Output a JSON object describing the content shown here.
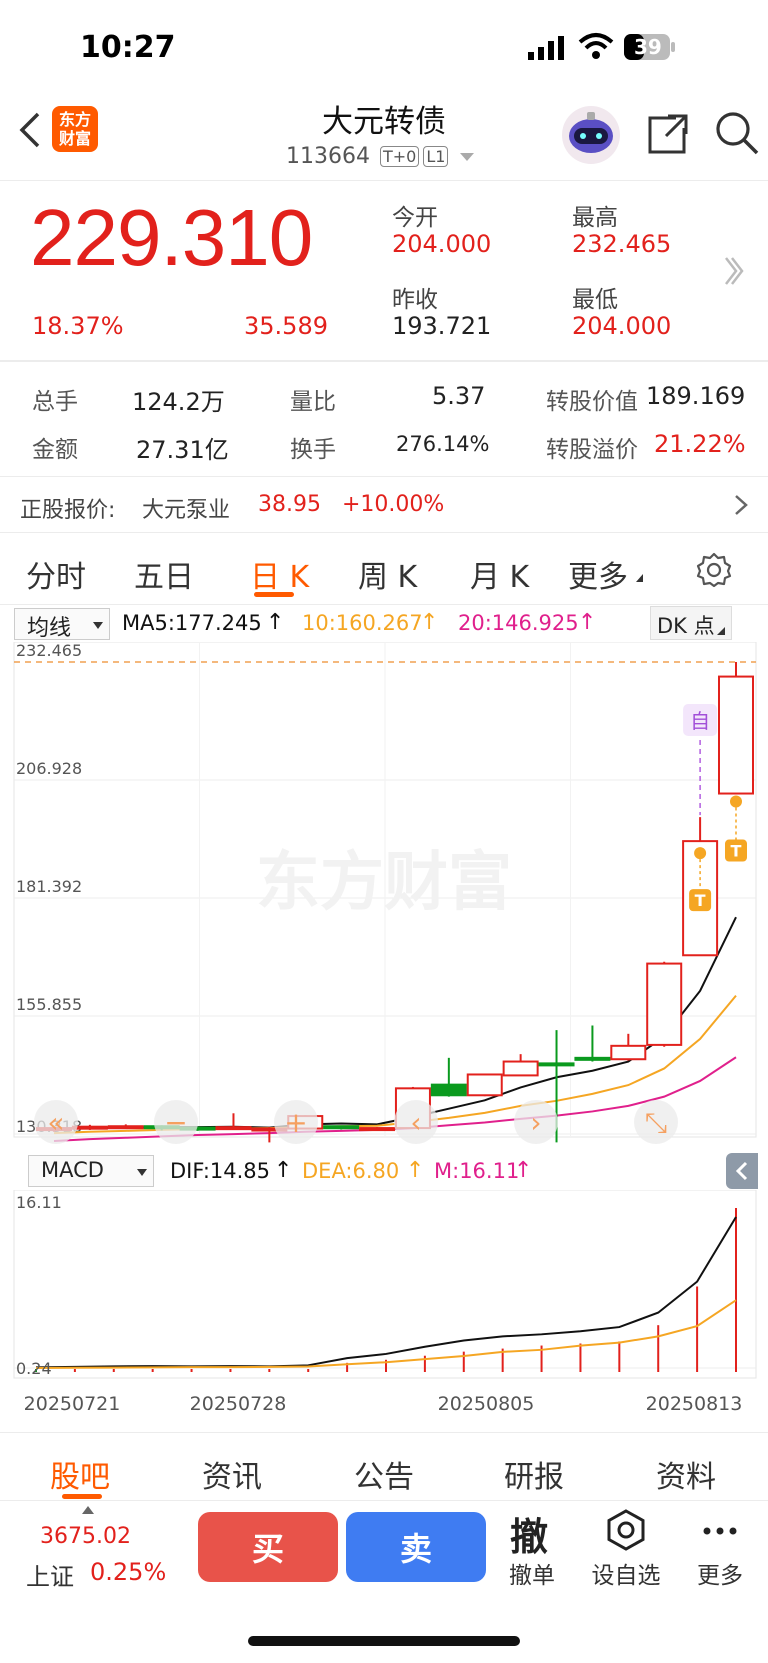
{
  "status_bar": {
    "time": "10:27",
    "battery": "39"
  },
  "header": {
    "logo_text": "东方\n财富",
    "title": "大元转债",
    "code": "113664",
    "badge_t0": "T+0",
    "badge_l1": "L1"
  },
  "quote": {
    "price": "229.310",
    "change_pct": "18.37%",
    "change_abs": "35.589",
    "open_label": "今开",
    "open": "204.000",
    "high_label": "最高",
    "high": "232.465",
    "prev_close_label": "昨收",
    "prev_close": "193.721",
    "low_label": "最低",
    "low": "204.000"
  },
  "stats": {
    "volume_label": "总手",
    "volume": "124.2万",
    "vol_ratio_label": "量比",
    "vol_ratio": "5.37",
    "conv_value_label": "转股价值",
    "conv_value": "189.169",
    "amount_label": "金额",
    "amount": "27.31亿",
    "turnover_label": "换手",
    "turnover": "276.14%",
    "premium_label": "转股溢价",
    "premium": "21.22%"
  },
  "stock_quote": {
    "label": "正股报价:",
    "name": "大元泵业",
    "price": "38.95",
    "change": "+10.00%"
  },
  "chart_tabs": [
    "分时",
    "五日",
    "日 K",
    "周 K",
    "月 K",
    "更多"
  ],
  "indicator_bar": {
    "selector": "均线",
    "ma5": "MA5:177.245",
    "ma10": "10:160.267",
    "ma20": "20:146.925",
    "dk": "DK 点"
  },
  "macd_bar": {
    "selector": "MACD",
    "dif": "DIF:14.85",
    "dea": "DEA:6.80",
    "m": "M:16.11"
  },
  "watermark": "东方财富",
  "markers": {
    "zi": "自",
    "t": "T"
  },
  "colors": {
    "up": "#e2211c",
    "down": "#0a9a1e",
    "accent": "#ff5a00",
    "ma10": "#f5a623",
    "ma20": "#e0208c",
    "buy": "#e8534a",
    "sell": "#3f7cf2"
  },
  "chart_data": [
    {
      "type": "candlestick",
      "y_tick_labels": [
        "232.465",
        "206.928",
        "181.392",
        "155.855",
        "130.318"
      ],
      "ylim": [
        130.318,
        232.465
      ],
      "x_tick_labels": [
        "20250721",
        "20250728",
        "20250805",
        "20250813"
      ],
      "candles": [
        {
          "open": 131.2,
          "close": 131.6,
          "high": 131.9,
          "low": 130.8
        },
        {
          "open": 131.6,
          "close": 131.9,
          "high": 132.3,
          "low": 131.2
        },
        {
          "open": 131.9,
          "close": 132.0,
          "high": 132.4,
          "low": 131.5
        },
        {
          "open": 132.0,
          "close": 131.7,
          "high": 132.2,
          "low": 131.1
        },
        {
          "open": 131.7,
          "close": 131.5,
          "high": 131.9,
          "low": 131.0
        },
        {
          "open": 131.5,
          "close": 131.8,
          "high": 134.8,
          "low": 131.2
        },
        {
          "open": 131.3,
          "close": 131.5,
          "high": 131.8,
          "low": 128.5
        },
        {
          "open": 131.5,
          "close": 134.2,
          "high": 134.4,
          "low": 131.4
        },
        {
          "open": 132.0,
          "close": 131.6,
          "high": 132.1,
          "low": 131.3
        },
        {
          "open": 131.6,
          "close": 131.6,
          "high": 131.8,
          "low": 131.3
        },
        {
          "open": 131.6,
          "close": 140.2,
          "high": 140.5,
          "low": 131.5
        },
        {
          "open": 141.0,
          "close": 138.7,
          "high": 146.8,
          "low": 138.4
        },
        {
          "open": 138.7,
          "close": 143.2,
          "high": 143.4,
          "low": 138.5
        },
        {
          "open": 143.0,
          "close": 146.0,
          "high": 147.6,
          "low": 143.0
        },
        {
          "open": 145.6,
          "close": 145.2,
          "high": 152.8,
          "low": 128.5
        },
        {
          "open": 146.8,
          "close": 146.5,
          "high": 153.8,
          "low": 146.0
        },
        {
          "open": 146.5,
          "close": 149.4,
          "high": 152.0,
          "low": 146.2
        },
        {
          "open": 149.6,
          "close": 167.2,
          "high": 167.6,
          "low": 149.2
        },
        {
          "open": 169.0,
          "close": 193.7,
          "high": 198.9,
          "low": 169.0
        },
        {
          "open": 204.0,
          "close": 229.31,
          "high": 232.465,
          "low": 204.0
        }
      ],
      "series": [
        {
          "name": "MA5",
          "values": [
            131.5,
            131.6,
            131.7,
            131.8,
            131.8,
            131.9,
            131.7,
            132.4,
            132.6,
            132.4,
            134.0,
            135.8,
            137.6,
            140.4,
            142.6,
            144.0,
            146.0,
            151.4,
            161.3,
            177.245
          ]
        },
        {
          "name": "10",
          "values": [
            130.5,
            130.8,
            131.0,
            131.2,
            131.4,
            131.5,
            131.6,
            131.8,
            132.0,
            132.1,
            132.9,
            133.8,
            134.9,
            136.4,
            137.5,
            139.0,
            140.9,
            144.5,
            150.9,
            160.267
          ]
        },
        {
          "name": "20",
          "values": [
            128.8,
            129.2,
            129.5,
            129.8,
            130.1,
            130.3,
            130.5,
            130.8,
            131.0,
            131.2,
            131.6,
            132.2,
            132.8,
            133.6,
            134.3,
            135.2,
            136.4,
            138.4,
            141.8,
            146.925
          ]
        }
      ]
    },
    {
      "type": "macd",
      "y_tick_labels": [
        "16.11",
        "0.24"
      ],
      "ylim": [
        0.24,
        16.11
      ],
      "series": [
        {
          "name": "DIF",
          "values": [
            0.3,
            0.35,
            0.4,
            0.42,
            0.4,
            0.42,
            0.4,
            0.5,
            1.2,
            1.6,
            2.3,
            2.9,
            3.3,
            3.5,
            3.8,
            4.2,
            5.6,
            8.6,
            14.85
          ]
        },
        {
          "name": "DEA",
          "values": [
            0.24,
            0.26,
            0.28,
            0.3,
            0.32,
            0.33,
            0.35,
            0.38,
            0.6,
            0.8,
            1.1,
            1.4,
            1.8,
            2.0,
            2.4,
            2.7,
            3.3,
            4.3,
            6.8
          ]
        },
        {
          "name": "M",
          "values": [
            0.05,
            0.06,
            0.08,
            0.07,
            0.05,
            0.05,
            0.04,
            0.08,
            0.9,
            1.2,
            1.6,
            2.0,
            2.3,
            2.6,
            2.8,
            3.0,
            4.6,
            8.4,
            16.11
          ]
        }
      ]
    }
  ],
  "bottom_tabs": [
    "股吧",
    "资讯",
    "公告",
    "研报",
    "资料"
  ],
  "footer": {
    "index_value": "3675.02",
    "index_name": "上证",
    "index_change": "0.25%",
    "buy": "买",
    "sell": "卖",
    "cancel_icon": "撤",
    "cancel_label": "撤单",
    "fav_label": "设自选",
    "more_label": "更多"
  }
}
